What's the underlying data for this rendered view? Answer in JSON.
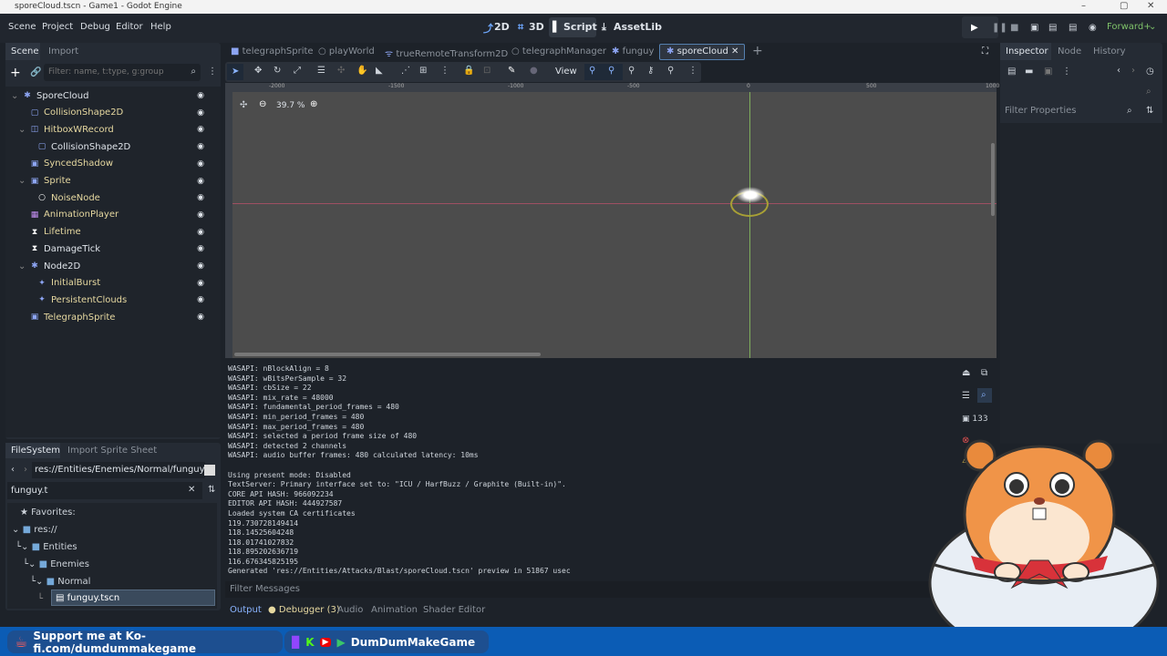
{
  "window": {
    "title": "sporeCloud.tscn - Game1 - Godot Engine",
    "controls": [
      "–",
      "▢",
      "✕"
    ]
  },
  "menu": [
    "Scene",
    "Project",
    "Debug",
    "Editor",
    "Help"
  ],
  "workspaces": [
    {
      "icon": "2d-icon",
      "label": "2D"
    },
    {
      "icon": "3d-icon",
      "label": "3D"
    },
    {
      "icon": "script-icon",
      "label": "Script"
    },
    {
      "icon": "assetlib-icon",
      "label": "AssetLib"
    }
  ],
  "renderer": "Forward+",
  "scene_dock": {
    "tabs": [
      "Scene",
      "Import"
    ],
    "filter_placeholder": "Filter: name, t:type, g:group",
    "nodes": [
      {
        "name": "SporeCloud",
        "depth": 0,
        "icon": "node2d",
        "color": "#8da5f3",
        "text": "#dfe4ea"
      },
      {
        "name": "CollisionShape2D",
        "depth": 1,
        "icon": "collision",
        "color": "#8da5f3",
        "text": "#e6d8a0"
      },
      {
        "name": "HitboxWRecord",
        "depth": 1,
        "icon": "area",
        "color": "#8da5f3",
        "text": "#e6d8a0"
      },
      {
        "name": "CollisionShape2D",
        "depth": 2,
        "icon": "collision",
        "color": "#8da5f3",
        "text": "#dfe4ea"
      },
      {
        "name": "SyncedShadow",
        "depth": 1,
        "icon": "sprite",
        "color": "#8da5f3",
        "text": "#e6d8a0"
      },
      {
        "name": "Sprite",
        "depth": 1,
        "icon": "sprite",
        "color": "#8da5f3",
        "text": "#e6d8a0"
      },
      {
        "name": "NoiseNode",
        "depth": 2,
        "icon": "node",
        "color": "#fff",
        "text": "#e6d8a0"
      },
      {
        "name": "AnimationPlayer",
        "depth": 1,
        "icon": "anim",
        "color": "#c38ef1",
        "text": "#e6d8a0"
      },
      {
        "name": "Lifetime",
        "depth": 1,
        "icon": "timer",
        "color": "#fff",
        "text": "#e6d8a0"
      },
      {
        "name": "DamageTick",
        "depth": 1,
        "icon": "timer",
        "color": "#fff",
        "text": "#dfe4ea"
      },
      {
        "name": "Node2D",
        "depth": 1,
        "icon": "node2d",
        "color": "#8da5f3",
        "text": "#dfe4ea"
      },
      {
        "name": "InitialBurst",
        "depth": 2,
        "icon": "particles",
        "color": "#8da5f3",
        "text": "#e6d8a0"
      },
      {
        "name": "PersistentClouds",
        "depth": 2,
        "icon": "particles",
        "color": "#8da5f3",
        "text": "#e6d8a0"
      },
      {
        "name": "TelegraphSprite",
        "depth": 1,
        "icon": "sprite",
        "color": "#8da5f3",
        "text": "#e6d8a0"
      }
    ]
  },
  "filesystem": {
    "tabs": [
      "FileSystem",
      "Import Sprite Sheet"
    ],
    "path": "res://Entities/Enemies/Normal/funguy.ts",
    "search": "funguy.t",
    "favorites": "Favorites:",
    "tree": [
      "res://",
      "Entities",
      "Enemies",
      "Normal",
      "funguy.tscn"
    ]
  },
  "scene_tabs": [
    "telegraphSprite",
    "playWorld",
    "trueRemoteTransform2D",
    "telegraphManager",
    "funguy",
    "sporeCloud"
  ],
  "toolbar": {
    "view": "View",
    "zoom": "39.7 %"
  },
  "ruler": [
    "-2000",
    "-1500",
    "-1000",
    "-500",
    "0",
    "500",
    "1000"
  ],
  "output": {
    "lines": [
      "WASAPI: nBlockAlign = 8",
      "WASAPI: wBitsPerSample = 32",
      "WASAPI: cbSize = 22",
      "WASAPI: mix_rate = 48000",
      "WASAPI: fundamental_period_frames = 480",
      "WASAPI: min_period_frames = 480",
      "WASAPI: max_period_frames = 480",
      "WASAPI: selected a period frame size of 480",
      "WASAPI: detected 2 channels",
      "WASAPI: audio buffer frames: 480 calculated latency: 10ms",
      "",
      "Using present mode: Disabled",
      "TextServer: Primary interface set to: \"ICU / HarfBuzz / Graphite (Built-in)\".",
      "CORE API HASH: 966092234",
      "EDITOR API HASH: 444927587",
      "Loaded system CA certificates",
      "119.730728149414",
      "118.14525604248",
      "118.01741027832",
      "118.895202636719",
      "116.676345825195",
      "Generated 'res://Entities/Attacks/Blast/sporeCloud.tscn' preview in 51867 usec"
    ],
    "filter_placeholder": "Filter Messages",
    "count": "133"
  },
  "bottom_tabs": [
    "Output",
    "Debugger (3)",
    "Audio",
    "Animation",
    "Shader Editor"
  ],
  "inspector": {
    "tabs": [
      "Inspector",
      "Node",
      "History"
    ],
    "filter_placeholder": "Filter Properties"
  },
  "banner": {
    "kofi": "Support me at Ko-fi.com/dumdummakegame",
    "social": "DumDumMakeGame"
  }
}
